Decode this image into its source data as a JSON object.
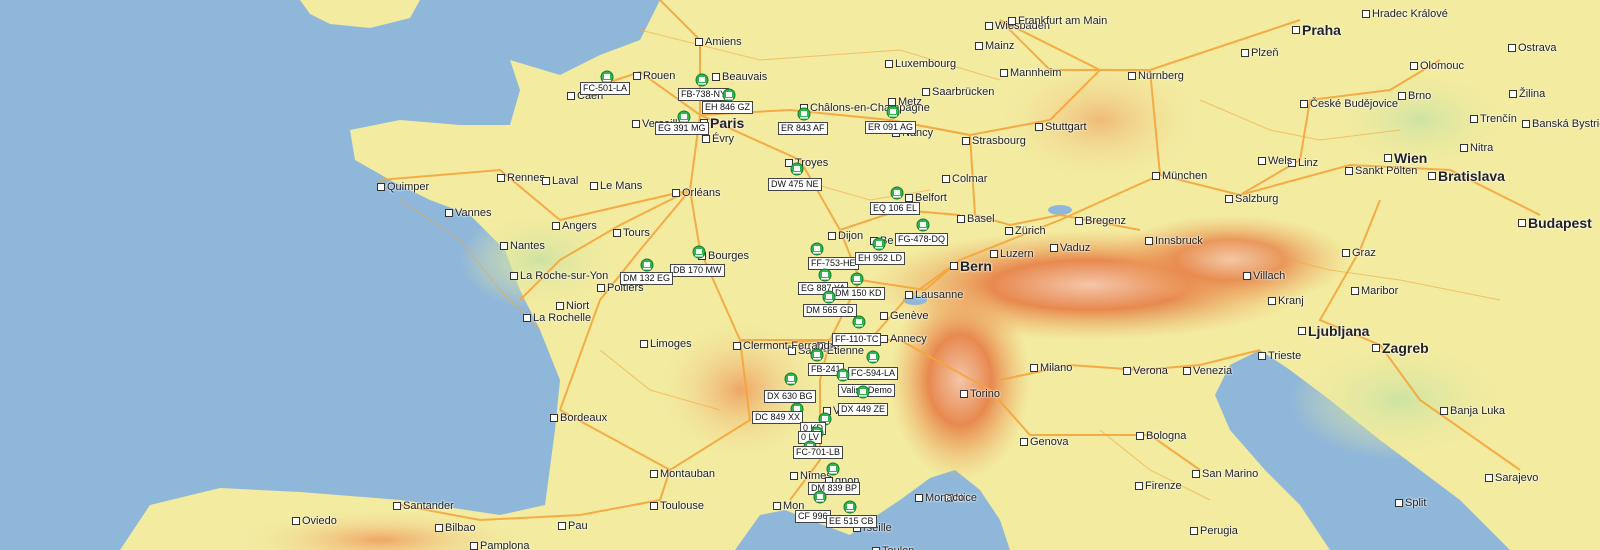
{
  "map": {
    "colors": {
      "sea": "#8fb7d9",
      "land": "#f2eba0",
      "lowland": "#f3e9a6",
      "alps": "#e38b53",
      "alps_high": "#f7d2b8",
      "road": "#f5a53a",
      "vehicle_green": "#2db84a"
    },
    "cities": [
      {
        "id": "amiens",
        "name": "Amiens",
        "cls": "mid"
      },
      {
        "id": "rouen",
        "name": "Rouen",
        "cls": "mid"
      },
      {
        "id": "caen",
        "name": "Caen",
        "cls": "mid"
      },
      {
        "id": "versailles",
        "name": "Versailles",
        "cls": "mid"
      },
      {
        "id": "paris",
        "name": "Paris",
        "cls": "big"
      },
      {
        "id": "evry",
        "name": "Évry",
        "cls": "mid"
      },
      {
        "id": "beauvais",
        "name": "Beauvais",
        "cls": "mid"
      },
      {
        "id": "chalons",
        "name": "Châlons-en-Champagne",
        "cls": "mid"
      },
      {
        "id": "metz",
        "name": "Metz",
        "cls": "mid"
      },
      {
        "id": "nancy",
        "name": "Nancy",
        "cls": "mid"
      },
      {
        "id": "troyes",
        "name": "Troyes",
        "cls": "mid"
      },
      {
        "id": "strasbourg",
        "name": "Strasbourg",
        "cls": "mid"
      },
      {
        "id": "luxembourg",
        "name": "Luxembourg",
        "cls": "mid"
      },
      {
        "id": "saarbrucken",
        "name": "Saarbrücken",
        "cls": "mid"
      },
      {
        "id": "mainz",
        "name": "Mainz",
        "cls": "mid"
      },
      {
        "id": "wiesbaden",
        "name": "Wiesbaden",
        "cls": "mid"
      },
      {
        "id": "frankfurt",
        "name": "Frankfurt am Main",
        "cls": "mid"
      },
      {
        "id": "mannheim",
        "name": "Mannheim",
        "cls": "mid"
      },
      {
        "id": "nurnberg",
        "name": "Nürnberg",
        "cls": "mid"
      },
      {
        "id": "stuttgart",
        "name": "Stuttgart",
        "cls": "mid"
      },
      {
        "id": "munchen",
        "name": "München",
        "cls": "mid"
      },
      {
        "id": "praha",
        "name": "Praha",
        "cls": "big"
      },
      {
        "id": "plzen",
        "name": "Plzeň",
        "cls": "mid"
      },
      {
        "id": "hradec",
        "name": "Hradec Králové",
        "cls": "mid"
      },
      {
        "id": "olomouc",
        "name": "Olomouc",
        "cls": "mid"
      },
      {
        "id": "ostrava",
        "name": "Ostrava",
        "cls": "mid"
      },
      {
        "id": "brno",
        "name": "Brno",
        "cls": "mid"
      },
      {
        "id": "zilina",
        "name": "Žilina",
        "cls": "mid"
      },
      {
        "id": "trencin",
        "name": "Trenčín",
        "cls": "mid"
      },
      {
        "id": "banska",
        "name": "Banská Bystrica",
        "cls": "mid"
      },
      {
        "id": "nitra",
        "name": "Nitra",
        "cls": "mid"
      },
      {
        "id": "budejovice",
        "name": "České Budějovice",
        "cls": "mid"
      },
      {
        "id": "linz",
        "name": "Linz",
        "cls": "mid"
      },
      {
        "id": "wels",
        "name": "Wels",
        "cls": "mid"
      },
      {
        "id": "wien",
        "name": "Wien",
        "cls": "big"
      },
      {
        "id": "bratislava",
        "name": "Bratislava",
        "cls": "big"
      },
      {
        "id": "budapest",
        "name": "Budapest",
        "cls": "big"
      },
      {
        "id": "sankt",
        "name": "Sankt Pölten",
        "cls": "mid"
      },
      {
        "id": "salzburg",
        "name": "Salzburg",
        "cls": "mid"
      },
      {
        "id": "innsbruck",
        "name": "Innsbruck",
        "cls": "mid"
      },
      {
        "id": "graz",
        "name": "Graz",
        "cls": "mid"
      },
      {
        "id": "villach",
        "name": "Villach",
        "cls": "mid"
      },
      {
        "id": "kranj",
        "name": "Kranj",
        "cls": "mid"
      },
      {
        "id": "maribor",
        "name": "Maribor",
        "cls": "mid"
      },
      {
        "id": "ljubljana",
        "name": "Ljubljana",
        "cls": "big"
      },
      {
        "id": "zagreb",
        "name": "Zagreb",
        "cls": "big"
      },
      {
        "id": "trieste",
        "name": "Trieste",
        "cls": "mid"
      },
      {
        "id": "venezia",
        "name": "Venezia",
        "cls": "mid"
      },
      {
        "id": "verona",
        "name": "Verona",
        "cls": "mid"
      },
      {
        "id": "milano",
        "name": "Milano",
        "cls": "mid"
      },
      {
        "id": "torino",
        "name": "Torino",
        "cls": "mid"
      },
      {
        "id": "genova",
        "name": "Genova",
        "cls": "mid"
      },
      {
        "id": "bologna",
        "name": "Bologna",
        "cls": "mid"
      },
      {
        "id": "firenze",
        "name": "Firenze",
        "cls": "mid"
      },
      {
        "id": "sanmarino",
        "name": "San Marino",
        "cls": "mid"
      },
      {
        "id": "perugia",
        "name": "Perugia",
        "cls": "mid"
      },
      {
        "id": "split",
        "name": "Split",
        "cls": "mid"
      },
      {
        "id": "sarajevo",
        "name": "Sarajevo",
        "cls": "mid"
      },
      {
        "id": "banja",
        "name": "Banja Luka",
        "cls": "mid"
      },
      {
        "id": "colmar",
        "name": "Colmar",
        "cls": "mid"
      },
      {
        "id": "basel",
        "name": "Basel",
        "cls": "mid"
      },
      {
        "id": "zurich",
        "name": "Zürich",
        "cls": "mid"
      },
      {
        "id": "bregenz",
        "name": "Bregenz",
        "cls": "mid"
      },
      {
        "id": "vaduz",
        "name": "Vaduz",
        "cls": "mid"
      },
      {
        "id": "luzern",
        "name": "Luzern",
        "cls": "mid"
      },
      {
        "id": "bern",
        "name": "Bern",
        "cls": "big"
      },
      {
        "id": "belfort",
        "name": "Belfort",
        "cls": "mid"
      },
      {
        "id": "besancon",
        "name": "Be",
        "cls": "mid"
      },
      {
        "id": "dijon",
        "name": "Dijon",
        "cls": "mid"
      },
      {
        "id": "lausanne",
        "name": "Lausanne",
        "cls": "mid"
      },
      {
        "id": "geneve",
        "name": "Genève",
        "cls": "mid"
      },
      {
        "id": "annecy",
        "name": "Annecy",
        "cls": "mid"
      },
      {
        "id": "lyon",
        "name": "on",
        "cls": "mid"
      },
      {
        "id": "stetienne",
        "name": "Saint-Étienne",
        "cls": "mid"
      },
      {
        "id": "valence",
        "name": "Va",
        "cls": "mid"
      },
      {
        "id": "nimes",
        "name": "Nîmes",
        "cls": "mid"
      },
      {
        "id": "avignon",
        "name": "gnon",
        "cls": "mid"
      },
      {
        "id": "montpellier",
        "name": "Mon",
        "cls": "mid"
      },
      {
        "id": "marseille",
        "name": "rseille",
        "cls": "mid"
      },
      {
        "id": "toulon",
        "name": "Toulon",
        "cls": "mid"
      },
      {
        "id": "nice",
        "name": "Nice",
        "cls": "mid"
      },
      {
        "id": "monaco",
        "name": "Monaco",
        "cls": "mid"
      },
      {
        "id": "clermont",
        "name": "Clermont-Ferrand",
        "cls": "mid"
      },
      {
        "id": "limoges",
        "name": "Limoges",
        "cls": "mid"
      },
      {
        "id": "bourges",
        "name": "Bourges",
        "cls": "mid"
      },
      {
        "id": "orleans",
        "name": "Orléans",
        "cls": "mid"
      },
      {
        "id": "tours",
        "name": "Tours",
        "cls": "mid"
      },
      {
        "id": "lemans",
        "name": "Le Mans",
        "cls": "mid"
      },
      {
        "id": "angers",
        "name": "Angers",
        "cls": "mid"
      },
      {
        "id": "nantes",
        "name": "Nantes",
        "cls": "mid"
      },
      {
        "id": "rennes",
        "name": "Rennes",
        "cls": "mid"
      },
      {
        "id": "laval",
        "name": "Laval",
        "cls": "mid"
      },
      {
        "id": "quimper",
        "name": "Quimper",
        "cls": "mid"
      },
      {
        "id": "vannes",
        "name": "Vannes",
        "cls": "mid"
      },
      {
        "id": "larochesuryon",
        "name": "La Roche-sur-Yon",
        "cls": "mid"
      },
      {
        "id": "larochelle",
        "name": "La Rochelle",
        "cls": "mid"
      },
      {
        "id": "niort",
        "name": "Niort",
        "cls": "mid"
      },
      {
        "id": "poitiers",
        "name": "Poitiers",
        "cls": "mid"
      },
      {
        "id": "bordeaux",
        "name": "Bordeaux",
        "cls": "mid"
      },
      {
        "id": "montauban",
        "name": "Montauban",
        "cls": "mid"
      },
      {
        "id": "toulouse",
        "name": "Toulouse",
        "cls": "mid"
      },
      {
        "id": "pau",
        "name": "Pau",
        "cls": "mid"
      },
      {
        "id": "bilbao",
        "name": "Bilbao",
        "cls": "mid"
      },
      {
        "id": "santander",
        "name": "Santander",
        "cls": "mid"
      },
      {
        "id": "oviedo",
        "name": "Oviedo",
        "cls": "mid"
      },
      {
        "id": "pamplona",
        "name": "Pamplona",
        "cls": "mid"
      }
    ],
    "vehicles": [
      {
        "plate": "FC-501-LA"
      },
      {
        "plate": "FB-738-NY"
      },
      {
        "plate": "EH 846 GZ"
      },
      {
        "plate": "EG 391 MG"
      },
      {
        "plate": "ER 843 AF"
      },
      {
        "plate": "ER 091 AG"
      },
      {
        "plate": "DW 475 NE"
      },
      {
        "plate": "EQ 106 EL"
      },
      {
        "plate": "FG-478-DQ"
      },
      {
        "plate": "DB 170 MW"
      },
      {
        "plate": "DM 132 EG"
      },
      {
        "plate": "FF-753-HE"
      },
      {
        "plate": "EH 952 LD"
      },
      {
        "plate": "EG 887 YA"
      },
      {
        "plate": "DM 150 KD"
      },
      {
        "plate": "DM 565 GD"
      },
      {
        "plate": "FF-110-TC"
      },
      {
        "plate": "FB-241"
      },
      {
        "plate": "FC-594-LA"
      },
      {
        "plate": "Valise-Demo"
      },
      {
        "plate": "DX 630 BG"
      },
      {
        "plate": "DX 449 ZE"
      },
      {
        "plate": "DC 849 XX"
      },
      {
        "plate": "0 KD"
      },
      {
        "plate": "0 LV"
      },
      {
        "plate": "FC-701-LB"
      },
      {
        "plate": "DM 839 BP"
      },
      {
        "plate": "CF 996"
      },
      {
        "plate": "EE 515 CB"
      }
    ]
  }
}
